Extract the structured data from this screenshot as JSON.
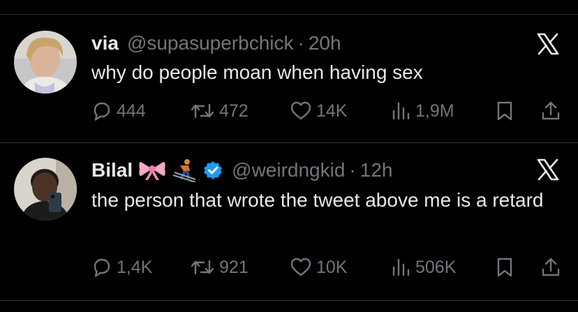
{
  "colors": {
    "background": "#000000",
    "text": "#e7e9ea",
    "muted": "#71767b",
    "divider": "#2f3336",
    "verified": "#1d9bf0"
  },
  "tweets": [
    {
      "display_name": "via",
      "handle": "@supasuperbchick",
      "separator": "·",
      "time": "20h",
      "badges": [],
      "text": "why do people moan when having sex",
      "replies": "444",
      "reposts": "472",
      "likes": "14K",
      "views": "1,9M"
    },
    {
      "display_name": "Bilal",
      "handle": "@weirdngkid",
      "separator": "·",
      "time": "12h",
      "badges": [
        "ribbon-emoji",
        "skier-emoji",
        "verified-badge-icon"
      ],
      "text": "the person that wrote the tweet above me is a retard",
      "replies": "1,4K",
      "reposts": "921",
      "likes": "10K",
      "views": "506K"
    }
  ]
}
